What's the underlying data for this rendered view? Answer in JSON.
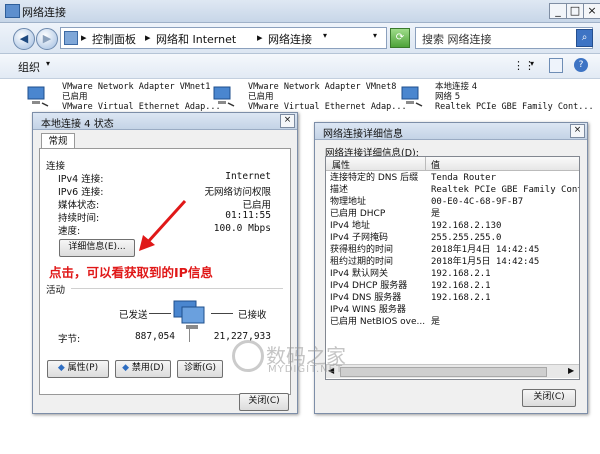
{
  "window": {
    "title": "网络连接"
  },
  "address": {
    "crumbs": [
      "控制面板",
      "网络和 Internet",
      "网络连接"
    ]
  },
  "search": {
    "placeholder": "搜索 网络连接"
  },
  "toolbar": {
    "organize": "组织"
  },
  "adapters": [
    {
      "name": "VMware Network Adapter VMnet1",
      "status": "已启用",
      "device": "VMware Virtual Ethernet Adap..."
    },
    {
      "name": "VMware Network Adapter VMnet8",
      "status": "已启用",
      "device": "VMware Virtual Ethernet Adap..."
    },
    {
      "name": "本地连接 4",
      "status": "网络 5",
      "device": "Realtek PCIe GBE Family Cont..."
    }
  ],
  "status_dialog": {
    "title": "本地连接 4 状态",
    "tab": "常规",
    "section_connection": "连接",
    "rows": [
      {
        "label": "IPv4 连接:",
        "value": "Internet"
      },
      {
        "label": "IPv6 连接:",
        "value": "无网络访问权限"
      },
      {
        "label": "媒体状态:",
        "value": "已启用"
      },
      {
        "label": "持续时间:",
        "value": "01:11:55"
      },
      {
        "label": "速度:",
        "value": "100.0 Mbps"
      }
    ],
    "details_button": "详细信息(E)...",
    "annotation": "点击，可以看获取到的IP信息",
    "section_activity": "活动",
    "sent_label": "已发送",
    "received_label": "已接收",
    "bytes_label": "字节:",
    "bytes_sent": "887,054",
    "bytes_received": "21,227,933",
    "properties_button": "属性(P)",
    "disable_button": "禁用(D)",
    "diagnose_button": "诊断(G)",
    "close_button": "关闭(C)"
  },
  "detail_dialog": {
    "title": "网络连接详细信息",
    "caption": "网络连接详细信息(D):",
    "col_property": "属性",
    "col_value": "值",
    "rows": [
      {
        "property": "连接特定的 DNS 后缀",
        "value": "Tenda Router"
      },
      {
        "property": "描述",
        "value": "Realtek PCIe GBE Family Controlle"
      },
      {
        "property": "物理地址",
        "value": "00-E0-4C-68-9F-B7"
      },
      {
        "property": "已启用 DHCP",
        "value": "是"
      },
      {
        "property": "IPv4 地址",
        "value": "192.168.2.130"
      },
      {
        "property": "IPv4 子网掩码",
        "value": "255.255.255.0"
      },
      {
        "property": "获得租约的时间",
        "value": "2018年1月4日 14:42:45"
      },
      {
        "property": "租约过期的时间",
        "value": "2018年1月5日 14:42:45"
      },
      {
        "property": "IPv4 默认网关",
        "value": "192.168.2.1"
      },
      {
        "property": "IPv4 DHCP 服务器",
        "value": "192.168.2.1"
      },
      {
        "property": "IPv4 DNS 服务器",
        "value": "192.168.2.1"
      },
      {
        "property": "IPv4 WINS 服务器",
        "value": ""
      },
      {
        "property": "已启用 NetBIOS ove...",
        "value": "是"
      }
    ],
    "close_button": "关闭(C)"
  },
  "watermark": {
    "text": "数码之家",
    "sub": "MYDIGIT.NET"
  },
  "colors": {
    "annotation": "#e01818",
    "arrow": "#e01818"
  }
}
